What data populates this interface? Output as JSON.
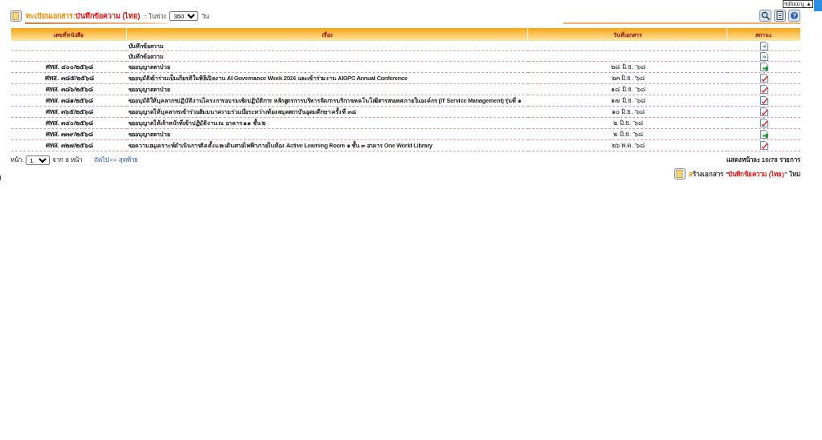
{
  "header": {
    "title_prefix": "ทะเบียนเอกสาร:",
    "title_name": "บันทึกข้อความ (ไทย)",
    "range_label": ":: ในช่วง",
    "range_value": "360",
    "range_unit": "วัน"
  },
  "corner_menu": {
    "label": "ขยับเมนู ▲"
  },
  "table": {
    "columns": [
      "เลขที่หนังสือ",
      "เรื่อง",
      "วันที่เอกสาร",
      "สถานะ"
    ],
    "rows": [
      {
        "number": "",
        "subject": "บันทึกข้อความ",
        "date": "",
        "kind": "draft"
      },
      {
        "number": "",
        "subject": "บันทึกข้อความ",
        "date": "",
        "kind": "draft"
      },
      {
        "number": "ศทส. ๔๐๐/๒๕๖๘",
        "subject": "ขออนุญาตลาป่วย",
        "date": "๒๘ มิ.ย. '๖๘",
        "kind": "sent"
      },
      {
        "number": "ศทส. ๓๘๕/๒๕๖๘",
        "subject": "ขออนุมัติเข้าร่วมเป็นเกียรติในพิธีเปิดงาน AI Governance Week 2026 และเข้าร่วมงาน AIGPC Annual Conference",
        "date": "๒๓ มิ.ย. '๖๘",
        "kind": "signed"
      },
      {
        "number": "ศทส. ๓๘๖/๒๕๖๘",
        "subject": "ขออนุญาตลาป่วย",
        "date": "๑๘ มิ.ย. '๖๘",
        "kind": "signed"
      },
      {
        "number": "ศทส. ๓๘๑/๒๕๖๘",
        "subject": "ขออนุมัติให้บุคลากรปฏิบัติงานโครงการอบรมเชิงปฏิบัติการ หลักสูตรการบริหารจัดการบริการเทคโนโลยีสารสนเทศภายในองค์กร (IT Service Management) รุ่นที่ ๑",
        "date": "๑๗ มิ.ย. '๖๘",
        "kind": "signed"
      },
      {
        "number": "ศทส. ๓๖๕/๒๕๖๘",
        "subject": "ขออนุญาตให้บุคลากรเข้าร่วมสัมมนาความร่วมมือระหว่างห้องสมุดสถาบันอุดมศึกษา ครั้งที่ ๓๘",
        "date": "๑๐ มิ.ย. '๖๘",
        "kind": "signed"
      },
      {
        "number": "ศทส. ๓๔๐/๒๕๖๘",
        "subject": "ขออนุญาตให้เจ้าหน้าที่เข้าปฏิบัติงาน ณ อาคาร ๑๑ ชั้น ๒",
        "date": "๒ มิ.ย. '๖๘",
        "kind": "signed"
      },
      {
        "number": "ศทส. ๓๓๙/๒๕๖๘",
        "subject": "ขออนุญาตลาป่วย",
        "date": "๒ มิ.ย. '๖๘",
        "kind": "sent"
      },
      {
        "number": "ศทส. ๓๒๗/๒๕๖๘",
        "subject": "ขอความอนุเคราะห์ดำเนินการติดตั้งและเดินสายไฟฟ้าภายในห้อง Active Learning Room ๑ ชั้น ๓ อาคาร One World Library",
        "date": "๒๖ พ.ค. '๖๘",
        "kind": "signed"
      }
    ]
  },
  "pager": {
    "page_label": "หน้า:",
    "page_value": "1",
    "page_total": "จาก 8 หน้า",
    "next_link": "ถัดไป>>",
    "last_link": "สุดท้าย",
    "summary": "แสดงหน้าละ 10/78 รายการ"
  },
  "create": {
    "first_letter": "ส",
    "text_before": "ร้างเอกสาร \"",
    "name": "บันทึกข้อความ (ไทย)",
    "text_after": "\" ใหม่"
  }
}
